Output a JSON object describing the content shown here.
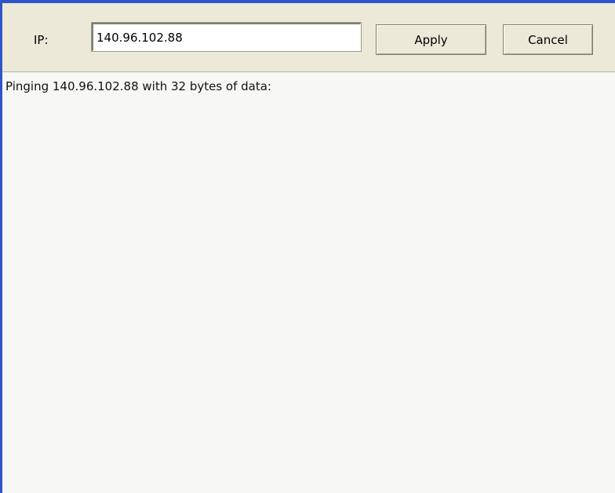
{
  "form": {
    "ip_label": "IP:",
    "ip_value": "140.96.102.88",
    "apply_label": "Apply",
    "cancel_label": "Cancel"
  },
  "output": {
    "text": "Pinging 140.96.102.88 with 32 bytes of data:"
  },
  "colors": {
    "window_border": "#2f55c8",
    "toolbar_bg": "#ece9d8",
    "output_bg": "#f7f7f5"
  }
}
